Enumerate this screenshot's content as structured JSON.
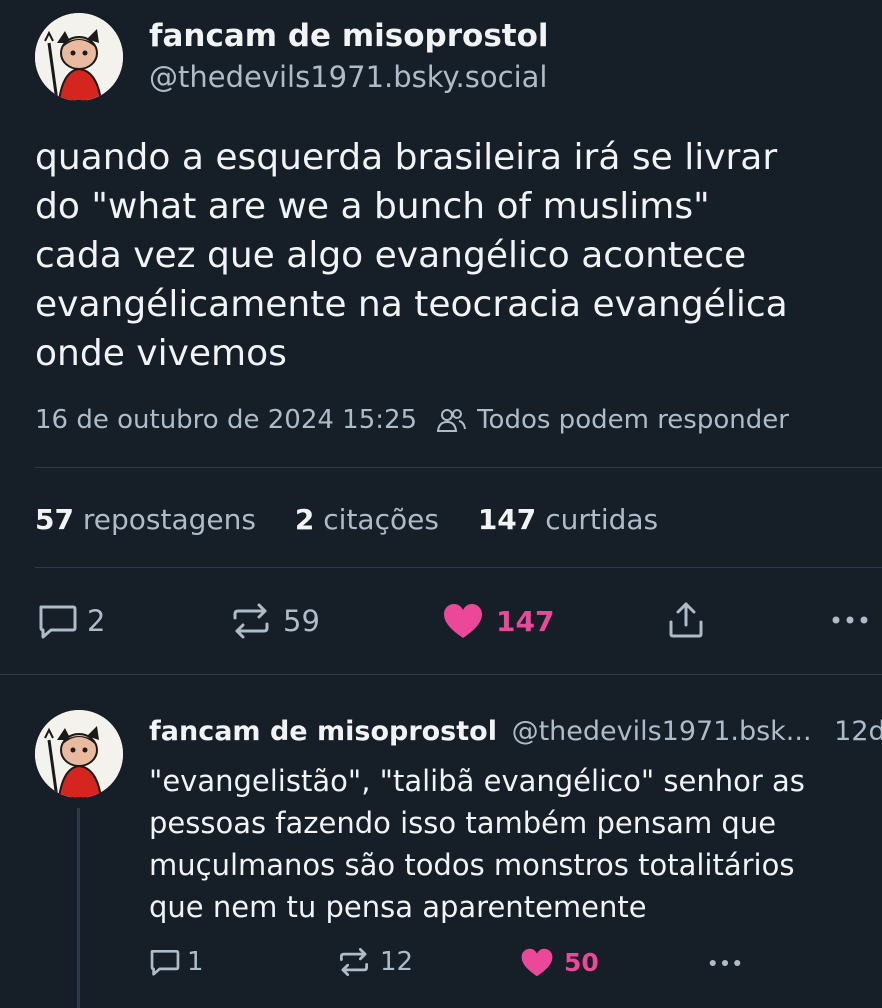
{
  "post": {
    "author_name": "fancam de misoprostol",
    "author_handle": "@thedevils1971.bsky.social",
    "text_lines": [
      "quando a esquerda brasileira irá se livrar",
      "do \"what are we a bunch of muslims\"",
      "cada vez que algo evangélico acontece",
      "evangélicamente na teocracia evangélica",
      "onde vivemos"
    ],
    "timestamp": "16 de outubro de 2024 15:25",
    "reply_setting": "Todos podem responder",
    "stats": {
      "reposts_count": "57",
      "reposts_label": "repostagens",
      "quotes_count": "2",
      "quotes_label": "citações",
      "likes_count": "147",
      "likes_label": "curtidas"
    },
    "actions": {
      "reply_count": "2",
      "repost_count": "59",
      "like_count": "147"
    }
  },
  "reply": {
    "author_name": "fancam de misoprostol",
    "author_handle": "@thedevils1971.bsk...",
    "age": "12d",
    "text_lines": [
      "\"evangelistão\", \"talibã evangélico\" senhor as",
      "pessoas fazendo isso também pensam que",
      "muçulmanos são todos monstros totalitários",
      "que nem tu pensa aparentemente"
    ],
    "actions": {
      "reply_count": "1",
      "repost_count": "12",
      "like_count": "50"
    }
  },
  "icons": {
    "reply": "speech-bubble-icon",
    "repost": "repost-arrows-icon",
    "like": "heart-icon",
    "share": "share-icon",
    "more": "more-dots-icon",
    "people": "people-icon"
  },
  "colors": {
    "background": "#161e27",
    "text": "#f1f3f5",
    "muted": "#aebbc9",
    "like_accent": "#ec4899",
    "divider": "#2e3a47"
  }
}
